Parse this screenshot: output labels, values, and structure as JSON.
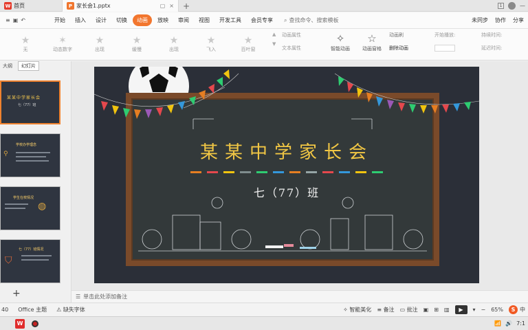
{
  "tabs": {
    "home_label": "首页",
    "doc_label": "家长会1.pptx",
    "new_tab": "+"
  },
  "menu": {
    "items": [
      "开始",
      "插入",
      "设计",
      "切换",
      "动画",
      "放映",
      "审阅",
      "视图",
      "开发工具",
      "会员专享"
    ],
    "active": "动画",
    "search_placeholder": "查找命令、搜索模板",
    "right_items": [
      "未同步",
      "协作",
      "分享"
    ]
  },
  "ribbon": {
    "animations": [
      "无",
      "动态数字",
      "出现",
      "缓慢",
      "出现",
      "飞入",
      "百叶窗"
    ],
    "group1": [
      "动画属性",
      "文本属性"
    ],
    "smart_anim": "智能动画",
    "anim_pane": "动画窗格",
    "group2": [
      "动画刷",
      "删除动画"
    ],
    "start_label": "开始播放:",
    "timing": [
      "持续时间:",
      "延迟时间:"
    ]
  },
  "left_panel": {
    "tabs": [
      "大纲",
      "幻灯片"
    ],
    "active_tab": "幻灯片",
    "thumbs": [
      {
        "title": "某某中学家长会",
        "sub": "七（77）班"
      },
      {
        "title": "学校办学理念"
      },
      {
        "title": "学生在校情况"
      },
      {
        "title": "七（77）班情况"
      }
    ]
  },
  "slide": {
    "title": "某某中学家长会",
    "subtitle": "七（77）班"
  },
  "notes": {
    "placeholder": "单击此处添加备注"
  },
  "status": {
    "slide_num": "40",
    "theme": "Office 主题",
    "missing_font": "缺失字体",
    "smart_beautify": "智能美化",
    "notes": "备注",
    "comments": "批注",
    "zoom": "65%",
    "ime": "中"
  },
  "taskbar": {
    "app": "W",
    "time": "7:1"
  },
  "colors": {
    "accent": "#f2762e",
    "slide_bg": "#2b2f38",
    "board_frame": "#7a4a2a",
    "title_gold": "#f2c744"
  }
}
